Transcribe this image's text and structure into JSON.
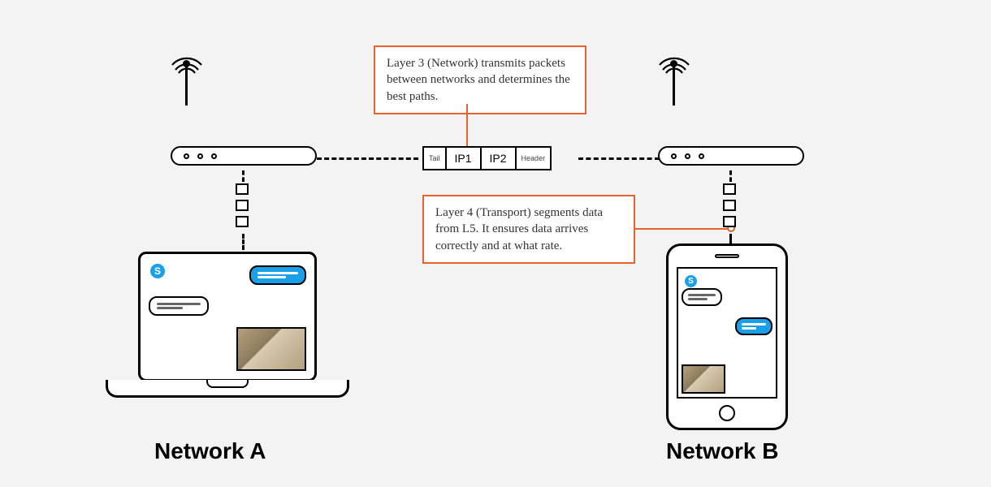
{
  "callouts": {
    "layer3": "Layer 3 (Network) transmits packets between networks and determines the best paths.",
    "layer4": "Layer 4 (Transport) segments data from L5. It ensures data arrives correctly and at what rate."
  },
  "packet": {
    "tail": "Tail",
    "ip1": "IP1",
    "ip2": "IP2",
    "header": "Header"
  },
  "labels": {
    "networkA": "Network A",
    "networkB": "Network B"
  },
  "icons": {
    "app": "S"
  }
}
